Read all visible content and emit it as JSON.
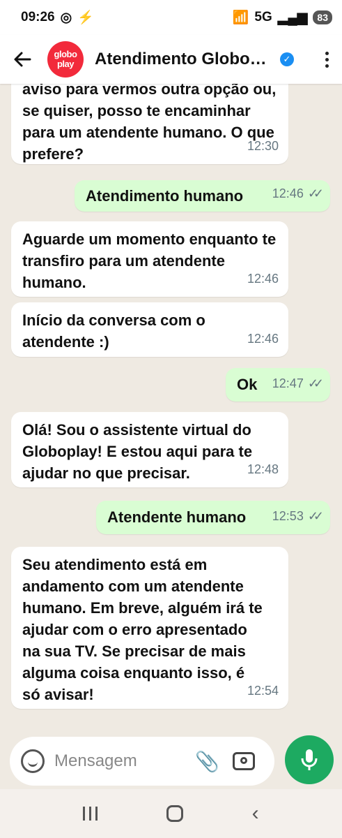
{
  "status": {
    "time": "09:26",
    "signal": "6",
    "network": "5G",
    "battery": "83"
  },
  "header": {
    "logo_line1": "globo",
    "logo_line2": "play",
    "title": "Atendimento Globoplay"
  },
  "messages": [
    {
      "type": "in",
      "text": "aviso para vermos outra opção ou, se quiser, posso te encaminhar para um atendente humano. O que prefere?",
      "time": "12:30"
    },
    {
      "type": "out",
      "text": "Atendimento humano",
      "time": "12:46"
    },
    {
      "type": "in",
      "text": "Aguarde um momento enquanto te transfiro para um atendente humano.",
      "time": "12:46"
    },
    {
      "type": "in",
      "text": "Início da conversa com o atendente :)",
      "time": "12:46"
    },
    {
      "type": "out",
      "text": "Ok",
      "time": "12:47"
    },
    {
      "type": "in",
      "text": "Olá! Sou o assistente virtual do Globoplay! E estou aqui para te ajudar no que precisar.",
      "time": "12:48"
    },
    {
      "type": "out",
      "text": "Atendente humano",
      "time": "12:53"
    },
    {
      "type": "in",
      "text": "Seu atendimento está em andamento com um atendente humano. Em breve, alguém irá te ajudar com o erro apresentado na sua TV. Se precisar de mais alguma coisa enquanto isso, é só avisar!",
      "time": "12:54"
    }
  ],
  "composer": {
    "placeholder": "Mensagem"
  },
  "icons": {
    "back": "back-arrow-icon",
    "verified": "verified-badge-icon",
    "menu": "more-options-icon",
    "emoji": "sticker-icon",
    "attach": "paperclip-icon",
    "camera": "camera-icon",
    "mic": "microphone-icon"
  },
  "colors": {
    "incoming": "#ffffff",
    "outgoing": "#d9fdd3",
    "accent": "#1daa61",
    "background": "#efeae2"
  }
}
